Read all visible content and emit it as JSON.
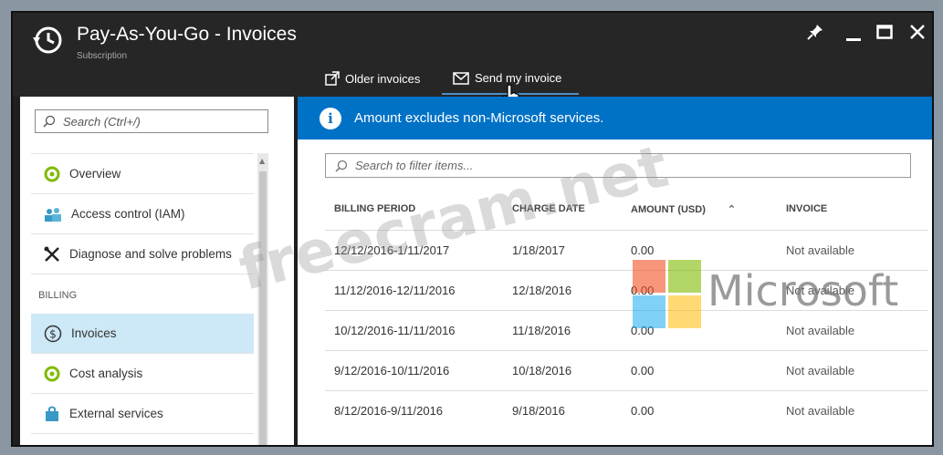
{
  "window": {
    "title": "Pay-As-You-Go - Invoices",
    "subtitle": "Subscription",
    "controls": {
      "pin": "✦",
      "minimize": "—",
      "maximize": "☐",
      "close": "✕"
    }
  },
  "commands": [
    {
      "label": "Older invoices",
      "icon": "external-link-icon"
    },
    {
      "label": "Send my invoice",
      "icon": "envelope-icon"
    }
  ],
  "sidebar": {
    "search_placeholder": "Search (Ctrl+/)",
    "items": [
      {
        "label": "Overview",
        "icon": "overview-icon"
      },
      {
        "label": "Access control (IAM)",
        "icon": "users-icon"
      },
      {
        "label": "Diagnose and solve problems",
        "icon": "tools-icon"
      }
    ],
    "billing_label": "BILLING",
    "billing_items": [
      {
        "label": "Invoices",
        "icon": "dollar-icon",
        "active": true
      },
      {
        "label": "Cost analysis",
        "icon": "cost-icon"
      },
      {
        "label": "External services",
        "icon": "bag-icon"
      }
    ]
  },
  "info_banner": {
    "text": "Amount excludes non-Microsoft services."
  },
  "filter": {
    "placeholder": "Search to filter items..."
  },
  "table": {
    "columns": [
      "BILLING PERIOD",
      "CHARGE DATE",
      "AMOUNT (USD)",
      "INVOICE"
    ],
    "rows": [
      [
        "12/12/2016-1/11/2017",
        "1/18/2017",
        "0.00",
        "Not available"
      ],
      [
        "11/12/2016-12/11/2016",
        "12/18/2016",
        "0.00",
        "Not available"
      ],
      [
        "10/12/2016-11/11/2016",
        "11/18/2016",
        "0.00",
        "Not available"
      ],
      [
        "9/12/2016-10/11/2016",
        "10/18/2016",
        "0.00",
        "Not available"
      ],
      [
        "8/12/2016-9/11/2016",
        "9/18/2016",
        "0.00",
        "Not available"
      ]
    ]
  },
  "watermark": {
    "text": "freecram.net",
    "brand": "Microsoft"
  },
  "colors": {
    "accent": "#0072c6",
    "active_nav": "#cde8f6",
    "titlebar": "#262626"
  }
}
